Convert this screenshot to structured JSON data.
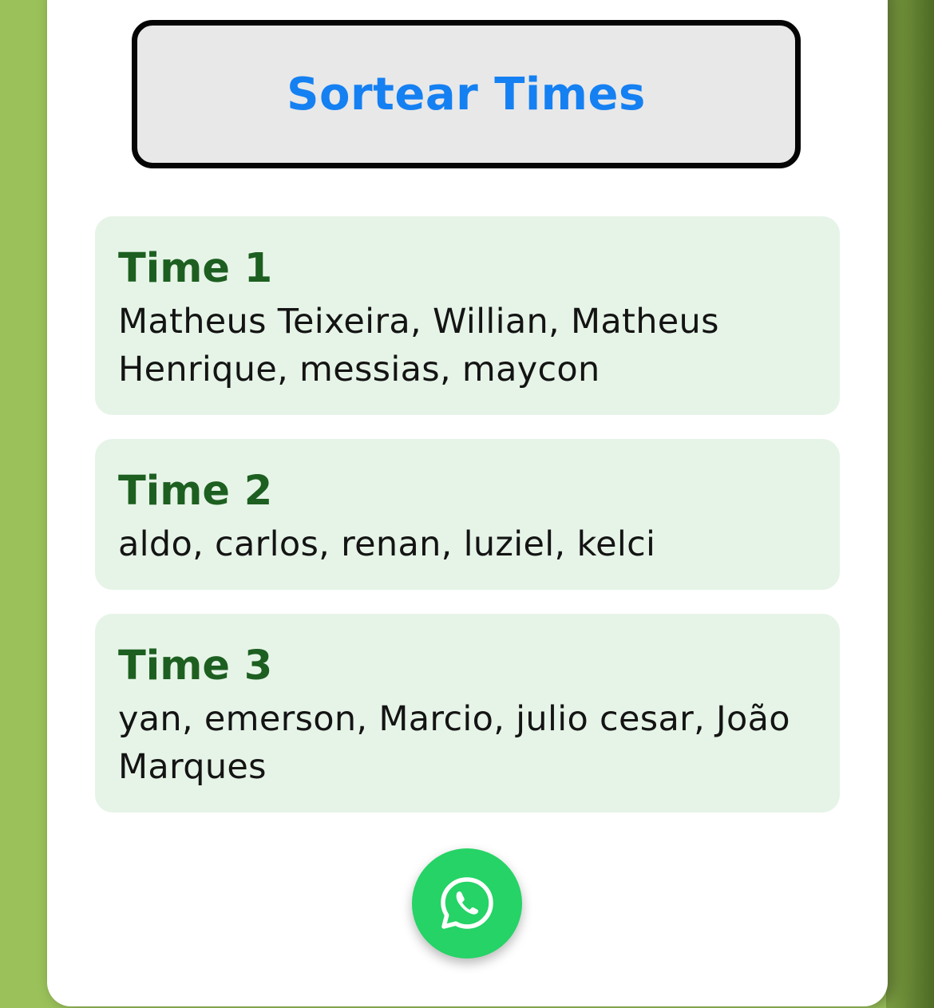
{
  "actions": {
    "sort_label": "Sortear Times"
  },
  "teams": [
    {
      "title": "Time 1",
      "players": "Matheus Teixeira, Willian, Matheus Henrique, messias, maycon"
    },
    {
      "title": "Time 2",
      "players": "aldo, carlos, renan, luziel, kelci"
    },
    {
      "title": "Time 3",
      "players": "yan, emerson, Marcio, julio cesar, João Marques"
    }
  ],
  "share": {
    "icon": "whatsapp-icon"
  },
  "colors": {
    "background_green": "#9bc25a",
    "button_text_blue": "#1580f2",
    "team_title_green": "#1d5f20",
    "team_box_bg": "#e6f4e7",
    "whatsapp_green": "#25d366"
  }
}
